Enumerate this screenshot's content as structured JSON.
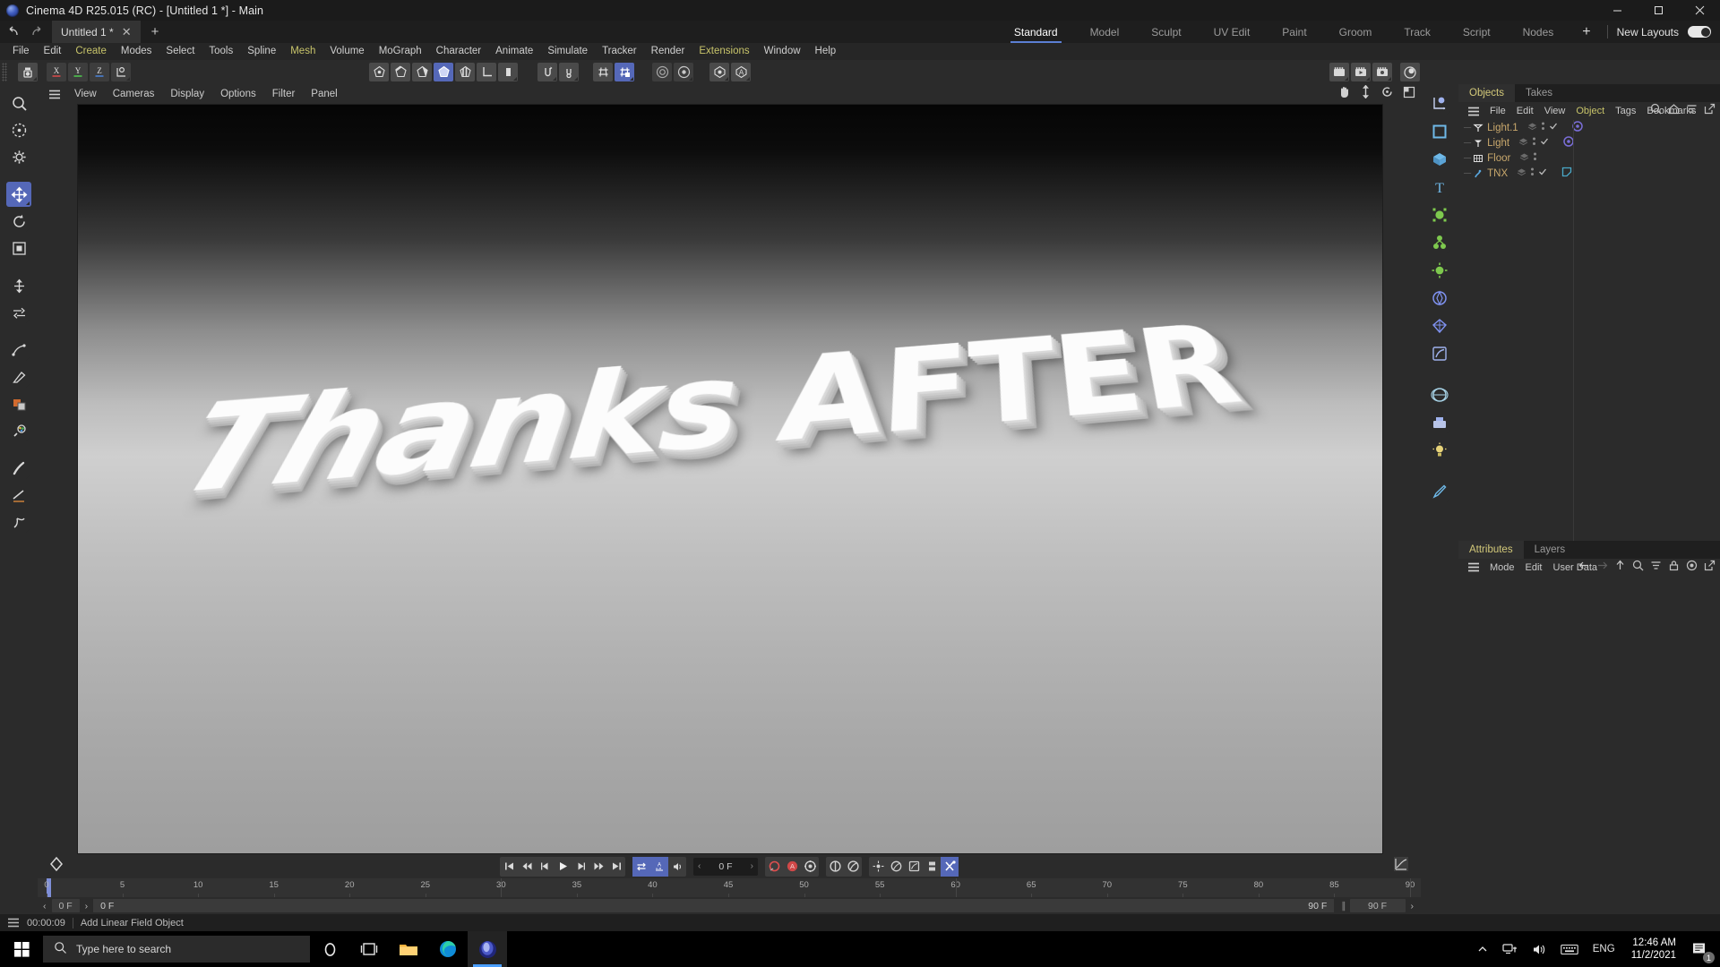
{
  "window": {
    "title": "Cinema 4D R25.015 (RC) - [Untitled 1 *] - Main",
    "app_icon": "cinema4d-logo-icon",
    "minimize": "–",
    "maximize": "☐",
    "close": "✕"
  },
  "tabs": {
    "undo_icon": "undo-arrow-icon",
    "redo_icon": "redo-arrow-icon",
    "document": "Untitled 1 *",
    "close_tab": "✕",
    "new_tab": "+"
  },
  "layouts": {
    "items": [
      "Standard",
      "Model",
      "Sculpt",
      "UV Edit",
      "Paint",
      "Groom",
      "Track",
      "Script",
      "Nodes"
    ],
    "active": "Standard",
    "add": "+",
    "label": "New Layouts",
    "toggle_on": true
  },
  "menubar": {
    "items": [
      {
        "label": "File",
        "highlight": false
      },
      {
        "label": "Edit",
        "highlight": false
      },
      {
        "label": "Create",
        "highlight": true
      },
      {
        "label": "Modes",
        "highlight": false
      },
      {
        "label": "Select",
        "highlight": false
      },
      {
        "label": "Tools",
        "highlight": false
      },
      {
        "label": "Spline",
        "highlight": false
      },
      {
        "label": "Mesh",
        "highlight": true
      },
      {
        "label": "Volume",
        "highlight": false
      },
      {
        "label": "MoGraph",
        "highlight": false
      },
      {
        "label": "Character",
        "highlight": false
      },
      {
        "label": "Animate",
        "highlight": false
      },
      {
        "label": "Simulate",
        "highlight": false
      },
      {
        "label": "Tracker",
        "highlight": false
      },
      {
        "label": "Render",
        "highlight": false
      },
      {
        "label": "Extensions",
        "highlight": true
      },
      {
        "label": "Window",
        "highlight": false
      },
      {
        "label": "Help",
        "highlight": false
      }
    ]
  },
  "main_toolbar": {
    "left_group": [
      "undo-redo-stack-icon"
    ],
    "axis_labels": [
      "X",
      "Y",
      "Z"
    ],
    "axis_colors": [
      "#d14a4a",
      "#4ec24e",
      "#4a7fd1"
    ],
    "object_axis_icon": "object-axis-icon",
    "mode_buttons": [
      "point-mode-icon",
      "edge-mode-icon",
      "polygon-mode-icon",
      "model-mode-icon",
      "texture-mode-icon",
      "workplane-icon",
      "axis-mode-icon"
    ],
    "mode_selected_index": 3,
    "snap_buttons": [
      "enable-snap-icon",
      "snap-settings-icon"
    ],
    "grid_buttons": [
      "workplane-grid-icon",
      "quantize-grid-icon"
    ],
    "grid_selected_index": 1,
    "render_buttons": [
      "render-view-icon",
      "render-region-icon"
    ],
    "material_buttons": [
      "render-settings-icon",
      "asset-browser-icon"
    ],
    "right_buttons": [
      "render-picture-viewer-icon",
      "render-to-pv-icon",
      "render-settings-gear-icon",
      "content-browser-icon"
    ]
  },
  "left_tools": {
    "items": [
      {
        "name": "live-selection-icon",
        "selected": false
      },
      {
        "name": "move-rotate-scale-circle-icon",
        "selected": false
      },
      {
        "name": "tool-settings-gear-icon",
        "selected": false
      },
      {
        "name": "move-tool-icon",
        "selected": true
      },
      {
        "name": "rotate-tool-icon",
        "selected": false
      },
      {
        "name": "scale-tool-icon",
        "selected": false
      },
      {
        "name": "transform-move-icon",
        "selected": false
      },
      {
        "name": "transfer-tool-icon",
        "selected": false
      },
      {
        "name": "spline-pen-icon",
        "selected": false
      },
      {
        "name": "spline-draw-icon",
        "selected": false
      },
      {
        "name": "material-color-icon",
        "selected": false
      },
      {
        "name": "paint-tool-icon",
        "selected": false
      },
      {
        "name": "brush-tool-icon",
        "selected": false
      },
      {
        "name": "knife-tool-icon",
        "selected": false
      },
      {
        "name": "sculpt-grab-icon",
        "selected": false
      }
    ]
  },
  "viewport": {
    "menu": [
      "View",
      "Cameras",
      "Display",
      "Options",
      "Filter",
      "Panel"
    ],
    "hamburger": "viewport-menu-icon",
    "right_icons": [
      "pan-hand-icon",
      "dolly-icon",
      "rotate-view-icon",
      "maximize-view-icon"
    ],
    "scene_text": "Thanks AFTER"
  },
  "timeline": {
    "keyframe_icon": "keyframe-diamond-icon",
    "transport": [
      "go-to-start-icon",
      "step-back-keyframe-icon",
      "step-back-frame-icon",
      "play-icon",
      "step-forward-frame-icon",
      "step-forward-keyframe-icon",
      "go-to-end-icon"
    ],
    "loop_buttons": [
      "loop-playback-icon",
      "sound-waveform-icon",
      "speaker-icon"
    ],
    "loop_selected": [
      true,
      true,
      false
    ],
    "current_frame": "0 F",
    "record_buttons": [
      "record-keyframe-icon",
      "autokey-icon",
      "keyframe-settings-icon"
    ],
    "anim_mode_buttons": [
      "position-key-icon",
      "rotation-key-icon"
    ],
    "pla_buttons": [
      "point-level-animation-icon",
      "parameter-key-icon",
      "auto-keying-icon",
      "keyframe-selection-icon",
      "animation-mode-icon"
    ],
    "pla_selected_index": 4,
    "curve_icon": "timeline-curve-icon",
    "ticks": [
      0,
      5,
      10,
      15,
      20,
      25,
      30,
      35,
      40,
      45,
      50,
      55,
      60,
      65,
      70,
      75,
      80,
      85,
      90
    ],
    "range_start": "0 F",
    "range_preview_start": "0 F",
    "range_preview_end": "90 F",
    "range_end": "90 F",
    "playhead_frame": 0
  },
  "right_icons": {
    "items": [
      {
        "name": "coordinate-manager-icon",
        "selected": false
      },
      {
        "name": "square-tool-icon",
        "selected": false
      },
      {
        "name": "cube-primitive-icon",
        "selected": false
      },
      {
        "name": "text-spline-icon",
        "selected": false
      },
      {
        "name": "deformer-icon",
        "selected": false
      },
      {
        "name": "mograph-icon",
        "selected": false
      },
      {
        "name": "environment-icon",
        "selected": false
      },
      {
        "name": "camera-icon",
        "selected": false
      },
      {
        "name": "light-icon",
        "selected": false
      },
      {
        "name": "field-icon",
        "selected": false
      },
      {
        "name": "material-sphere-icon",
        "selected": false
      },
      {
        "name": "scene-nodes-icon",
        "selected": false
      },
      {
        "name": "lighting-icon",
        "selected": false
      },
      {
        "name": "edit-render-settings-icon",
        "selected": false
      }
    ]
  },
  "object_manager": {
    "tabs": [
      "Objects",
      "Takes"
    ],
    "active_tab": "Objects",
    "menu": [
      {
        "label": "File",
        "highlight": false
      },
      {
        "label": "Edit",
        "highlight": false
      },
      {
        "label": "View",
        "highlight": false
      },
      {
        "label": "Object",
        "highlight": true
      },
      {
        "label": "Tags",
        "highlight": false
      },
      {
        "label": "Bookmarks",
        "highlight": false
      }
    ],
    "hamburger": "object-manager-menu-icon",
    "header_icons": [
      "search-icon",
      "home-icon",
      "filter-icon",
      "open-external-icon"
    ],
    "objects": [
      {
        "name": "Light.1",
        "icon": "light-object-icon",
        "has_visibility_dots": true,
        "has_check": true,
        "tag": "light-tag-icon"
      },
      {
        "name": "Light",
        "icon": "light-object-icon",
        "has_visibility_dots": true,
        "has_check": true,
        "tag": "light-tag-icon"
      },
      {
        "name": "Floor",
        "icon": "floor-object-icon",
        "has_visibility_dots": true,
        "has_check": false,
        "tag": null
      },
      {
        "name": "TNX",
        "icon": "spline-object-icon",
        "has_visibility_dots": true,
        "has_check": true,
        "tag": "phong-tag-icon"
      }
    ]
  },
  "attributes_manager": {
    "tabs": [
      "Attributes",
      "Layers"
    ],
    "active_tab": "Attributes",
    "menu": [
      "Mode",
      "Edit",
      "User Data"
    ],
    "hamburger": "attributes-menu-icon",
    "header_icons": [
      "back-arrow-icon",
      "forward-arrow-icon",
      "up-arrow-icon",
      "search-icon",
      "filter-icon",
      "lock-icon",
      "target-icon",
      "open-external-icon"
    ]
  },
  "status_bar": {
    "hamburger": "status-menu-icon",
    "time": "00:00:09",
    "message": "Add Linear Field Object"
  },
  "taskbar": {
    "start_icon": "windows-start-icon",
    "search_placeholder": "Type here to search",
    "search_icon": "search-icon",
    "apps": [
      {
        "name": "cortana-icon",
        "active": false
      },
      {
        "name": "task-view-icon",
        "active": false
      },
      {
        "name": "file-explorer-icon",
        "active": false
      },
      {
        "name": "microsoft-edge-icon",
        "active": false
      },
      {
        "name": "cinema4d-taskbar-icon",
        "active": true
      }
    ],
    "tray": {
      "chevron": "show-hidden-icons-icon",
      "network": "network-icon",
      "volume": "volume-icon",
      "keyboard": "keyboard-icon",
      "language": "ENG",
      "time": "12:46 AM",
      "date": "11/2/2021",
      "notifications": "notifications-icon",
      "notification_count": "1"
    }
  },
  "colors": {
    "accent": "#5568b8",
    "menu_highlight": "#c8c46a",
    "object_text": "#c9a86c",
    "panel_bg": "#2b2b2b"
  }
}
